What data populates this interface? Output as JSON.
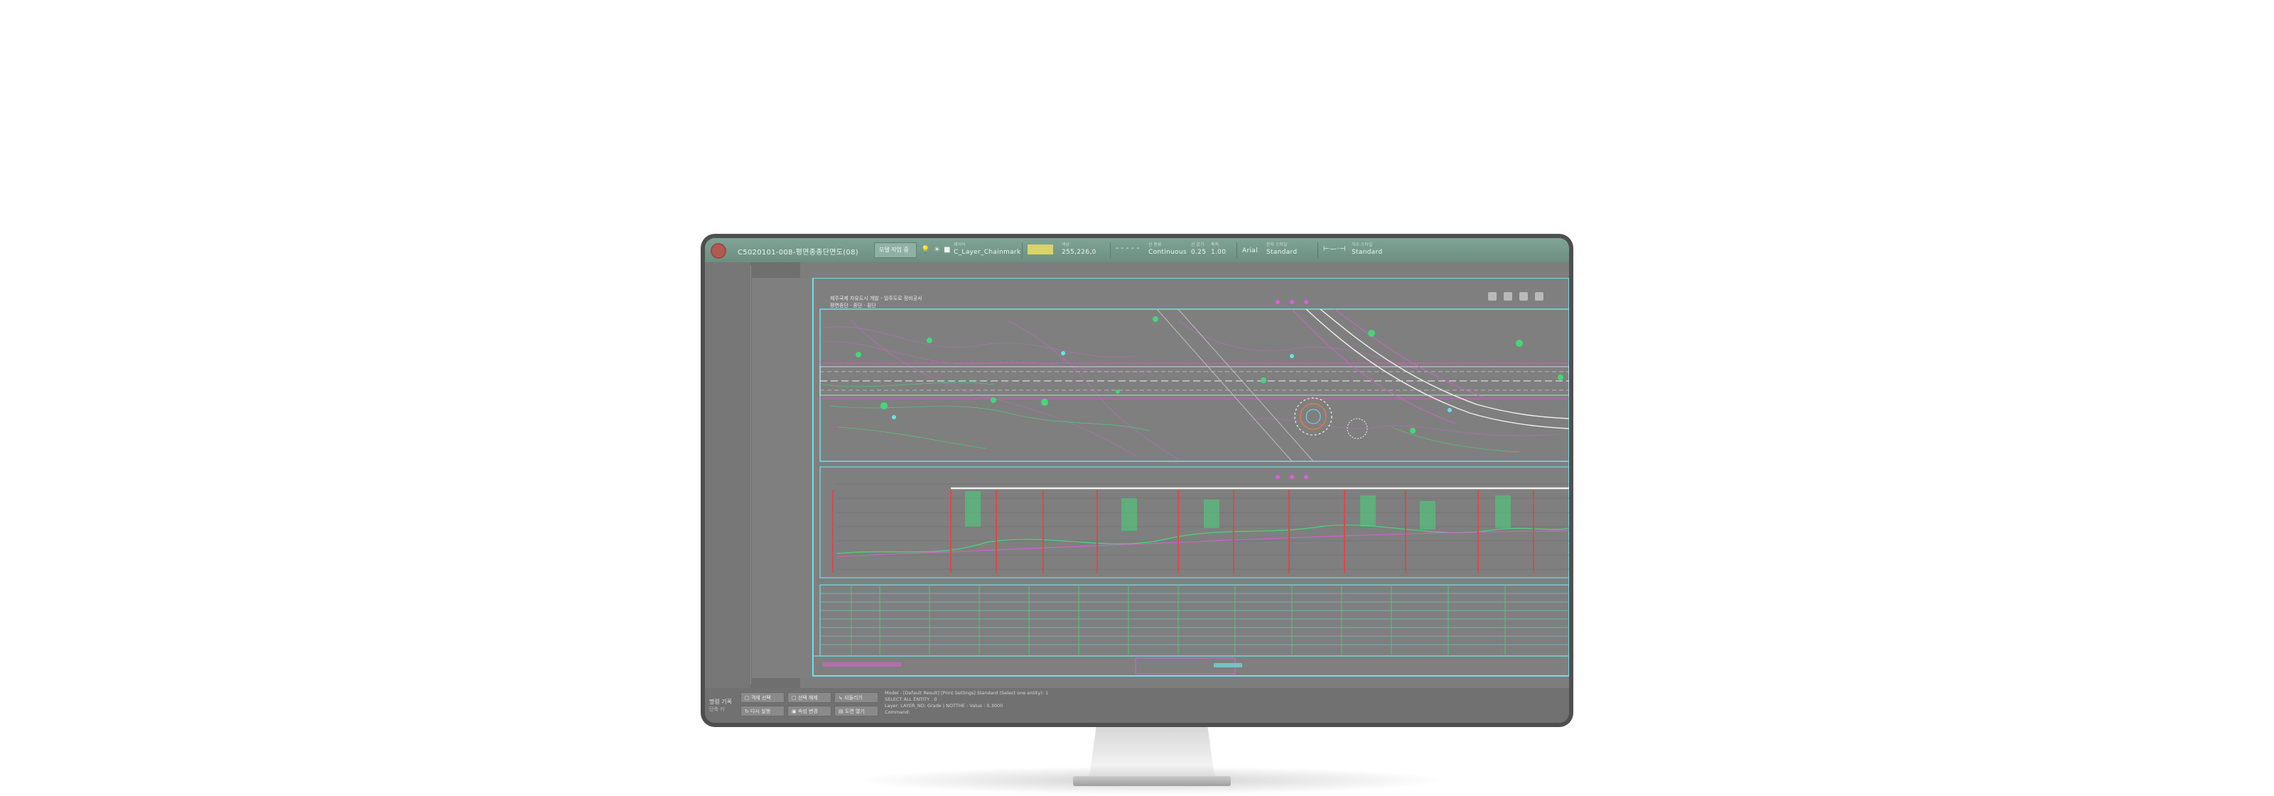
{
  "topbar": {
    "file_name": "C5020101-008-평면종종단면도(08)",
    "tab_label": "모델 작업 중",
    "layer_caption": "레이어",
    "layer_value": "C_Layer_Chainmark",
    "color_caption": "색상",
    "color_value": "255,226,0",
    "linetype_caption": "선 종류",
    "linetype_value": "Continuous",
    "lineweight_caption": "선 굵기",
    "lineweight_value": "0.25",
    "scale_caption": "축척",
    "scale_value": "1.00",
    "font_value": "Arial",
    "textstyle_caption": "문자 스타일",
    "textstyle_value": "Standard",
    "dimstyle_caption": "치수 스타일",
    "dimstyle_value": "Standard",
    "swatch_color": "#d8d46a"
  },
  "sheet": {
    "title_line1": "제주국제 자유도시 개발 - 일주도로 정비공사",
    "title_line2": "평면종단 · 종단 · 횡단"
  },
  "command": {
    "label_line1": "명령 기록",
    "label_line2": "단축 키",
    "buttons": [
      {
        "label": "□ 객체 선택"
      },
      {
        "label": "□ 선택 해제"
      },
      {
        "label": "↳ 되돌리기"
      },
      {
        "label": "↻ 다시 실행"
      },
      {
        "label": "▣ 속성 변경"
      },
      {
        "label": "▤ 도면 열기"
      }
    ],
    "lines": [
      "Model - [Default Result] [Print Settings] Standard (Select one entity): 1",
      "SELECT ALL ENTITY : 0",
      "Layer: LAYER_NO: Grade | NOTTHE : Value : 0.3000",
      "Command:"
    ]
  },
  "colors": {
    "cyan": "#6fe0e6",
    "green": "#45d67a",
    "magenta": "#d95fd6",
    "red": "#e0464a",
    "topbar": "#7fa597"
  }
}
